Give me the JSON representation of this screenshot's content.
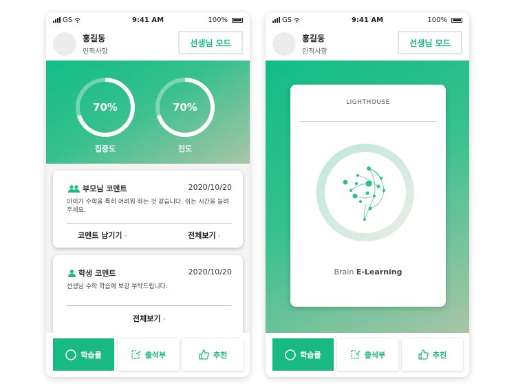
{
  "status": {
    "carrier": "GS",
    "time": "9:41 AM",
    "battery": "100%"
  },
  "header": {
    "name": "홍길동",
    "subtitle": "인적사항",
    "mode_button": "선생님 모드"
  },
  "gauges": [
    {
      "value": "70%",
      "label": "집중도",
      "fraction": 0.7
    },
    {
      "value": "70%",
      "label": "진도",
      "fraction": 0.7
    }
  ],
  "comments": [
    {
      "title": "부모님 코멘트",
      "date": "2020/10/20",
      "body": "아이가 수학을 특히 어려워 하는 것 같습니다. 쉬는 시간을 늘려주세요.",
      "actions": [
        "코멘트 남기기",
        "전체보기"
      ]
    },
    {
      "title": "학생 코멘트",
      "date": "2020/10/20",
      "body": "선생님 수학 학습에 보강 부탁드립니다.",
      "actions": [
        "전체보기"
      ]
    }
  ],
  "tabs": [
    {
      "label": "학습률",
      "icon": "circle-icon",
      "active": true
    },
    {
      "label": "출석부",
      "icon": "attendance-icon",
      "active": false
    },
    {
      "label": "추천",
      "icon": "thumbs-up-icon",
      "active": false
    }
  ],
  "lighthouse": {
    "title": "LIGHTHOUSE",
    "footer_light": "Brain",
    "footer_bold": "E-Learning"
  },
  "colors": {
    "accent": "#19b983",
    "gradient_end": "#a9c5a7"
  }
}
